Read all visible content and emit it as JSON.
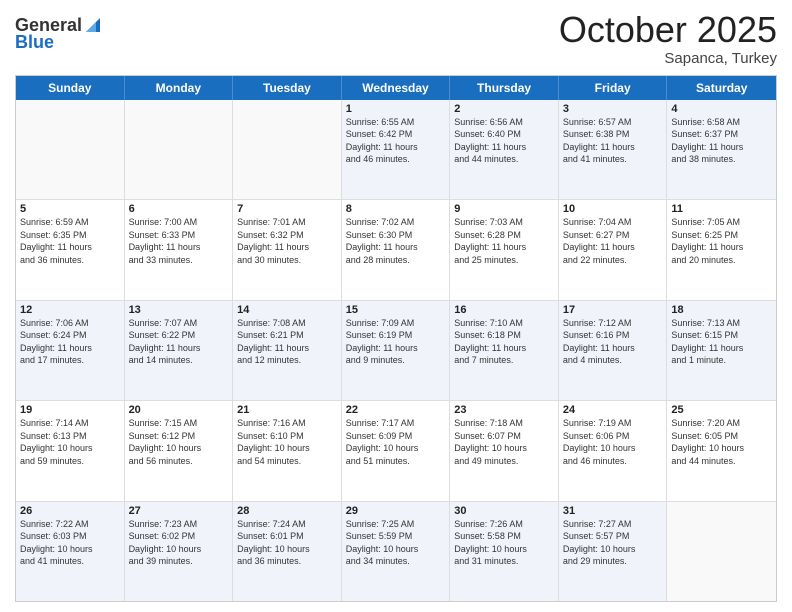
{
  "header": {
    "logo_line1": "General",
    "logo_line2": "Blue",
    "month": "October 2025",
    "location": "Sapanca, Turkey"
  },
  "days_of_week": [
    "Sunday",
    "Monday",
    "Tuesday",
    "Wednesday",
    "Thursday",
    "Friday",
    "Saturday"
  ],
  "weeks": [
    [
      {
        "day": "",
        "info": ""
      },
      {
        "day": "",
        "info": ""
      },
      {
        "day": "",
        "info": ""
      },
      {
        "day": "1",
        "info": "Sunrise: 6:55 AM\nSunset: 6:42 PM\nDaylight: 11 hours\nand 46 minutes."
      },
      {
        "day": "2",
        "info": "Sunrise: 6:56 AM\nSunset: 6:40 PM\nDaylight: 11 hours\nand 44 minutes."
      },
      {
        "day": "3",
        "info": "Sunrise: 6:57 AM\nSunset: 6:38 PM\nDaylight: 11 hours\nand 41 minutes."
      },
      {
        "day": "4",
        "info": "Sunrise: 6:58 AM\nSunset: 6:37 PM\nDaylight: 11 hours\nand 38 minutes."
      }
    ],
    [
      {
        "day": "5",
        "info": "Sunrise: 6:59 AM\nSunset: 6:35 PM\nDaylight: 11 hours\nand 36 minutes."
      },
      {
        "day": "6",
        "info": "Sunrise: 7:00 AM\nSunset: 6:33 PM\nDaylight: 11 hours\nand 33 minutes."
      },
      {
        "day": "7",
        "info": "Sunrise: 7:01 AM\nSunset: 6:32 PM\nDaylight: 11 hours\nand 30 minutes."
      },
      {
        "day": "8",
        "info": "Sunrise: 7:02 AM\nSunset: 6:30 PM\nDaylight: 11 hours\nand 28 minutes."
      },
      {
        "day": "9",
        "info": "Sunrise: 7:03 AM\nSunset: 6:28 PM\nDaylight: 11 hours\nand 25 minutes."
      },
      {
        "day": "10",
        "info": "Sunrise: 7:04 AM\nSunset: 6:27 PM\nDaylight: 11 hours\nand 22 minutes."
      },
      {
        "day": "11",
        "info": "Sunrise: 7:05 AM\nSunset: 6:25 PM\nDaylight: 11 hours\nand 20 minutes."
      }
    ],
    [
      {
        "day": "12",
        "info": "Sunrise: 7:06 AM\nSunset: 6:24 PM\nDaylight: 11 hours\nand 17 minutes."
      },
      {
        "day": "13",
        "info": "Sunrise: 7:07 AM\nSunset: 6:22 PM\nDaylight: 11 hours\nand 14 minutes."
      },
      {
        "day": "14",
        "info": "Sunrise: 7:08 AM\nSunset: 6:21 PM\nDaylight: 11 hours\nand 12 minutes."
      },
      {
        "day": "15",
        "info": "Sunrise: 7:09 AM\nSunset: 6:19 PM\nDaylight: 11 hours\nand 9 minutes."
      },
      {
        "day": "16",
        "info": "Sunrise: 7:10 AM\nSunset: 6:18 PM\nDaylight: 11 hours\nand 7 minutes."
      },
      {
        "day": "17",
        "info": "Sunrise: 7:12 AM\nSunset: 6:16 PM\nDaylight: 11 hours\nand 4 minutes."
      },
      {
        "day": "18",
        "info": "Sunrise: 7:13 AM\nSunset: 6:15 PM\nDaylight: 11 hours\nand 1 minute."
      }
    ],
    [
      {
        "day": "19",
        "info": "Sunrise: 7:14 AM\nSunset: 6:13 PM\nDaylight: 10 hours\nand 59 minutes."
      },
      {
        "day": "20",
        "info": "Sunrise: 7:15 AM\nSunset: 6:12 PM\nDaylight: 10 hours\nand 56 minutes."
      },
      {
        "day": "21",
        "info": "Sunrise: 7:16 AM\nSunset: 6:10 PM\nDaylight: 10 hours\nand 54 minutes."
      },
      {
        "day": "22",
        "info": "Sunrise: 7:17 AM\nSunset: 6:09 PM\nDaylight: 10 hours\nand 51 minutes."
      },
      {
        "day": "23",
        "info": "Sunrise: 7:18 AM\nSunset: 6:07 PM\nDaylight: 10 hours\nand 49 minutes."
      },
      {
        "day": "24",
        "info": "Sunrise: 7:19 AM\nSunset: 6:06 PM\nDaylight: 10 hours\nand 46 minutes."
      },
      {
        "day": "25",
        "info": "Sunrise: 7:20 AM\nSunset: 6:05 PM\nDaylight: 10 hours\nand 44 minutes."
      }
    ],
    [
      {
        "day": "26",
        "info": "Sunrise: 7:22 AM\nSunset: 6:03 PM\nDaylight: 10 hours\nand 41 minutes."
      },
      {
        "day": "27",
        "info": "Sunrise: 7:23 AM\nSunset: 6:02 PM\nDaylight: 10 hours\nand 39 minutes."
      },
      {
        "day": "28",
        "info": "Sunrise: 7:24 AM\nSunset: 6:01 PM\nDaylight: 10 hours\nand 36 minutes."
      },
      {
        "day": "29",
        "info": "Sunrise: 7:25 AM\nSunset: 5:59 PM\nDaylight: 10 hours\nand 34 minutes."
      },
      {
        "day": "30",
        "info": "Sunrise: 7:26 AM\nSunset: 5:58 PM\nDaylight: 10 hours\nand 31 minutes."
      },
      {
        "day": "31",
        "info": "Sunrise: 7:27 AM\nSunset: 5:57 PM\nDaylight: 10 hours\nand 29 minutes."
      },
      {
        "day": "",
        "info": ""
      }
    ]
  ]
}
